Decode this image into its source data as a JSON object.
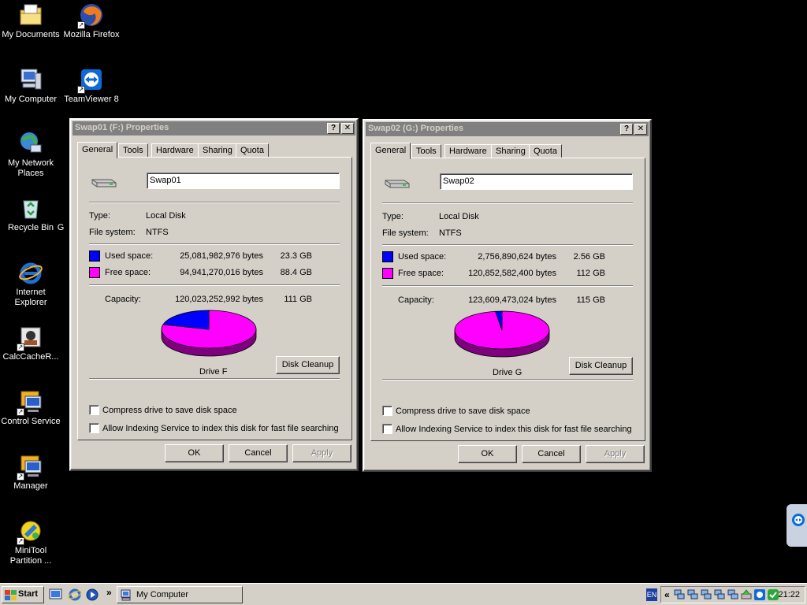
{
  "desktop": {
    "icons": [
      {
        "label": "My Documents",
        "icon": "my-documents-icon"
      },
      {
        "label": "Mozilla Firefox",
        "icon": "firefox-icon"
      },
      {
        "label": "My Computer",
        "icon": "my-computer-icon"
      },
      {
        "label": "TeamViewer 8",
        "icon": "teamviewer-icon"
      },
      {
        "label": "My Network Places",
        "icon": "network-places-icon"
      },
      {
        "label": "Recycle Bin",
        "icon": "recycle-bin-icon"
      },
      {
        "label": "Internet Explorer",
        "icon": "internet-explorer-icon"
      },
      {
        "label": "CalcCacheR...",
        "icon": "calccache-icon"
      },
      {
        "label": "Control Service",
        "icon": "control-service-icon"
      },
      {
        "label": "Manager",
        "icon": "manager-icon"
      },
      {
        "label": "MiniTool Partition ...",
        "icon": "minitool-icon"
      }
    ],
    "partial_label": "G"
  },
  "dialogs": [
    {
      "title": "Swap01 (F:) Properties",
      "tabs": [
        "General",
        "Tools",
        "Hardware",
        "Sharing",
        "Quota"
      ],
      "name_value": "Swap01",
      "type_label": "Type:",
      "type_value": "Local Disk",
      "fs_label": "File system:",
      "fs_value": "NTFS",
      "used_label": "Used space:",
      "used_bytes": "25,081,982,976 bytes",
      "used_size": "23.3 GB",
      "free_label": "Free space:",
      "free_bytes": "94,941,270,016 bytes",
      "free_size": "88.4 GB",
      "capacity_label": "Capacity:",
      "capacity_bytes": "120,023,252,992 bytes",
      "capacity_size": "111 GB",
      "used_fraction": 0.209,
      "drive_label": "Drive F",
      "cleanup_label": "Disk Cleanup",
      "compress_label": "Compress drive to save disk space",
      "index_label": "Allow Indexing Service to index this disk for fast file searching",
      "ok_label": "OK",
      "cancel_label": "Cancel",
      "apply_label": "Apply"
    },
    {
      "title": "Swap02 (G:) Properties",
      "tabs": [
        "General",
        "Tools",
        "Hardware",
        "Sharing",
        "Quota"
      ],
      "name_value": "Swap02",
      "type_label": "Type:",
      "type_value": "Local Disk",
      "fs_label": "File system:",
      "fs_value": "NTFS",
      "used_label": "Used space:",
      "used_bytes": "2,756,890,624 bytes",
      "used_size": "2.56 GB",
      "free_label": "Free space:",
      "free_bytes": "120,852,582,400 bytes",
      "free_size": "112 GB",
      "capacity_label": "Capacity:",
      "capacity_bytes": "123,609,473,024 bytes",
      "capacity_size": "115 GB",
      "used_fraction": 0.0223,
      "drive_label": "Drive G",
      "cleanup_label": "Disk Cleanup",
      "compress_label": "Compress drive to save disk space",
      "index_label": "Allow Indexing Service to index this disk for fast file searching",
      "ok_label": "OK",
      "cancel_label": "Cancel",
      "apply_label": "Apply"
    }
  ],
  "colors": {
    "used": "#0000ff",
    "free": "#ff00ff",
    "used_dark": "#00007f",
    "free_dark": "#7f007f"
  },
  "taskbar": {
    "start_label": "Start",
    "chevron": "»",
    "task_label": "My Computer",
    "lang": "EN",
    "tray_chevron": "«",
    "clock": "21:22"
  }
}
